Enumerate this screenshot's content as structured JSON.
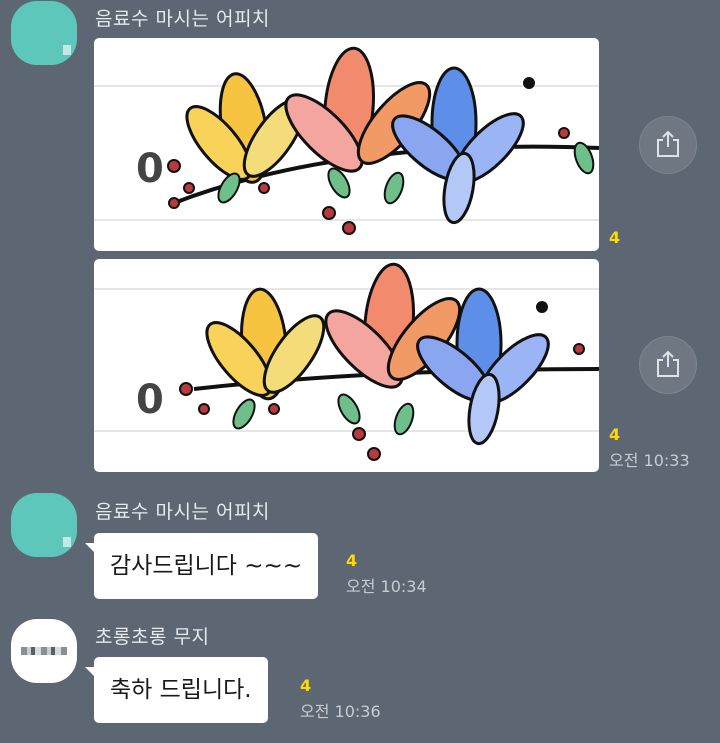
{
  "messages": [
    {
      "sender": "음료수 마시는 어피치",
      "avatar_color": "#5ec7bb",
      "photos": [
        {
          "number_label": "0",
          "unread": "4"
        },
        {
          "number_label": "0",
          "unread": "4",
          "time": "오전 10:33"
        }
      ]
    },
    {
      "sender": "음료수 마시는 어피치",
      "avatar_color": "#5ec7bb",
      "text": "감사드립니다 ~~~",
      "unread": "4",
      "time": "오전 10:34"
    },
    {
      "sender": "초롱초롱 무지",
      "avatar_color": "#ffffff",
      "text": "축하 드립니다.",
      "unread": "4",
      "time": "오전 10:36"
    }
  ],
  "icons": {
    "share": "share-icon"
  },
  "colors": {
    "background": "#5d6673",
    "unread": "#ffd900",
    "bubble": "#ffffff"
  }
}
